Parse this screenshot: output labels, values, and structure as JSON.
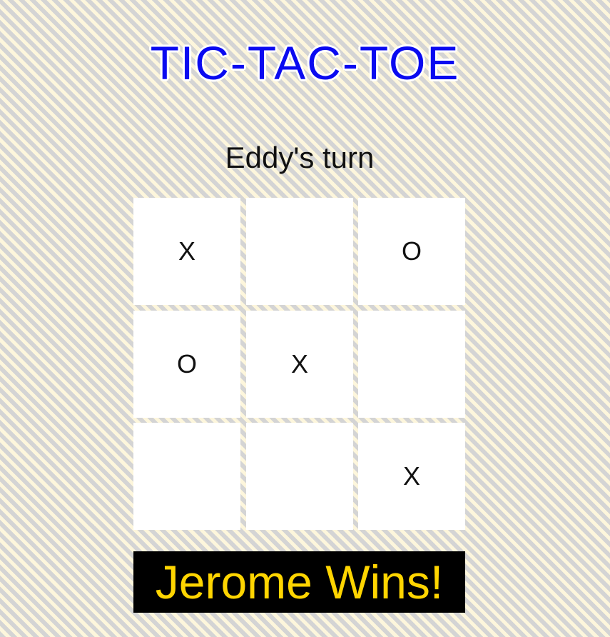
{
  "title": "TIC-TAC-TOE",
  "turn_text": "Eddy's turn",
  "board": {
    "cells": [
      "X",
      "",
      "O",
      "O",
      "X",
      "",
      "",
      "",
      "X"
    ]
  },
  "result_text": "Jerome Wins!",
  "colors": {
    "title": "#0a0af0",
    "result_text": "#ffd500",
    "result_background": "#000000",
    "cell_background": "#ffffff"
  }
}
